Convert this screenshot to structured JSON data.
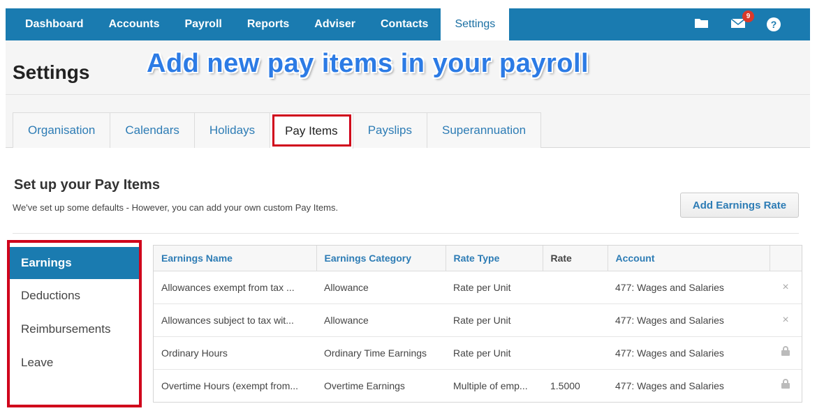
{
  "nav": {
    "items": [
      "Dashboard",
      "Accounts",
      "Payroll",
      "Reports",
      "Adviser",
      "Contacts",
      "Settings"
    ],
    "active": "Settings",
    "notification_count": "9",
    "icons": [
      "folder-icon",
      "mail-icon",
      "help-icon"
    ]
  },
  "header": {
    "title": "Settings",
    "caption": "Add new pay items in your payroll"
  },
  "tabs": [
    "Organisation",
    "Calendars",
    "Holidays",
    "Pay Items",
    "Payslips",
    "Superannuation"
  ],
  "section": {
    "title": "Set up your Pay Items",
    "description": "We've set up some defaults - However, you can add your own custom Pay Items.",
    "add_button": "Add Earnings Rate"
  },
  "side_menu": [
    "Earnings",
    "Deductions",
    "Reimbursements",
    "Leave"
  ],
  "table": {
    "headers": [
      "Earnings Name",
      "Earnings Category",
      "Rate Type",
      "Rate",
      "Account",
      ""
    ],
    "rows": [
      {
        "name": "Allowances exempt from tax ...",
        "category": "Allowance",
        "rate_type": "Rate per Unit",
        "rate": "",
        "account": "477: Wages and Salaries",
        "action": "×"
      },
      {
        "name": "Allowances subject to tax wit...",
        "category": "Allowance",
        "rate_type": "Rate per Unit",
        "rate": "",
        "account": "477: Wages and Salaries",
        "action": "×"
      },
      {
        "name": "Ordinary Hours",
        "category": "Ordinary Time Earnings",
        "rate_type": "Rate per Unit",
        "rate": "",
        "account": "477: Wages and Salaries",
        "action": "lock"
      },
      {
        "name": "Overtime Hours (exempt from...",
        "category": "Overtime Earnings",
        "rate_type": "Multiple of emp...",
        "rate": "1.5000",
        "account": "477: Wages and Salaries",
        "action": "lock"
      }
    ]
  },
  "colors": {
    "nav_bg": "#1a7bb0",
    "link": "#2d7cb5",
    "highlight_border": "#d0021b",
    "caption": "#2c7be5",
    "badge": "#d9392b"
  }
}
